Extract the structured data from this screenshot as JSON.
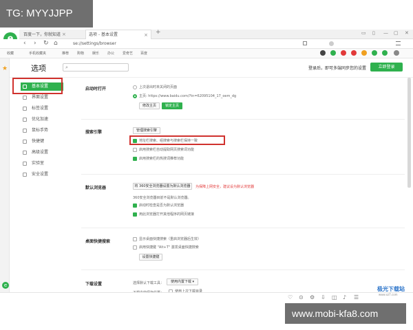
{
  "watermarks": {
    "top": "TG: MYYJJPP",
    "bottom": "www.mobi-kfa8.com"
  },
  "browser": {
    "logo_letter": "e",
    "tabs": [
      {
        "label": "百度一下，你就知道",
        "close": "×"
      },
      {
        "label": "选项 - 基本设置",
        "close": "×"
      }
    ],
    "new_tab": "+",
    "window_controls": [
      "▭",
      "▯",
      "—",
      "▢",
      "✕"
    ],
    "address": "se://settings/browser",
    "nav_icons": [
      "‹",
      "›",
      "↻",
      "⌂"
    ],
    "bookmarks": [
      "收藏",
      "手机收藏夹",
      "推荐",
      "购物",
      "娱乐",
      "办公",
      "爱奇艺",
      "百度"
    ],
    "colors": {
      "accent": "#2fb14e",
      "warning": "#e23a3a",
      "highlight": "#d0312d"
    }
  },
  "page": {
    "title": "选项",
    "search_placeholder": "",
    "login_prompt": "登录后，即可多端同步您的设置",
    "login_button": "立即登录"
  },
  "menu": [
    {
      "label": "基本设置",
      "active": true
    },
    {
      "label": "界面设置",
      "active": false
    },
    {
      "label": "标签设置",
      "active": false
    },
    {
      "label": "优化加速",
      "active": false
    },
    {
      "label": "鼠标手势",
      "active": false
    },
    {
      "label": "快捷键",
      "active": false
    },
    {
      "label": "高级设置",
      "active": false
    },
    {
      "label": "实验室",
      "active": false
    },
    {
      "label": "安全设置",
      "active": false
    }
  ],
  "sections": {
    "startup": {
      "label": "启动时打开",
      "opt_last": "上次退出时未关闭的页面",
      "opt_home_prefix": "主页",
      "home_url": "https://www.baidu.com/?tn=62095104_17_oem_dg",
      "btn_change_home": "修改主页",
      "btn_lock_home": "锁定主页"
    },
    "search": {
      "label": "搜索引擎",
      "btn_manage": "管理搜索引擎",
      "opt_sync": "地址栏搜索、组搜索与搜索栏保持一致",
      "opt_auto_suggest": "启用搜索栏自动提取网页搜索词功能",
      "opt_hot": "启用搜索栏的热搜词推荐功能"
    },
    "default_browser": {
      "label": "默认浏览器",
      "btn_set_default": "将 360安全浏览器设置为默认浏览器",
      "warning": "为保障上网安全，建议设为默认浏览器",
      "status": "360安全浏览器目前不是默认浏览器。",
      "opt_check": "启动时检查是否为默认浏览器",
      "opt_open_links": "用此浏览器打开其他程序的网页链接"
    },
    "desktop_search": {
      "label": "桌面快捷搜索",
      "opt_show": "显示桌面快捷搜索（重启浏览器后生效）",
      "opt_alt": "启用快捷键 \"Alt+T\" 激发桌面快捷搜索",
      "btn_setup": "设置快捷键"
    },
    "download": {
      "label": "下载设置",
      "tool_label": "选择默认下载工具：",
      "tool_value": "使用内置下载 ▾",
      "location_label": "下载内容保存位置：",
      "opt_last_dir": "使用上次下载目录"
    }
  },
  "site_logo": {
    "name": "极光下载站",
    "sub": "www.xz7.com"
  }
}
